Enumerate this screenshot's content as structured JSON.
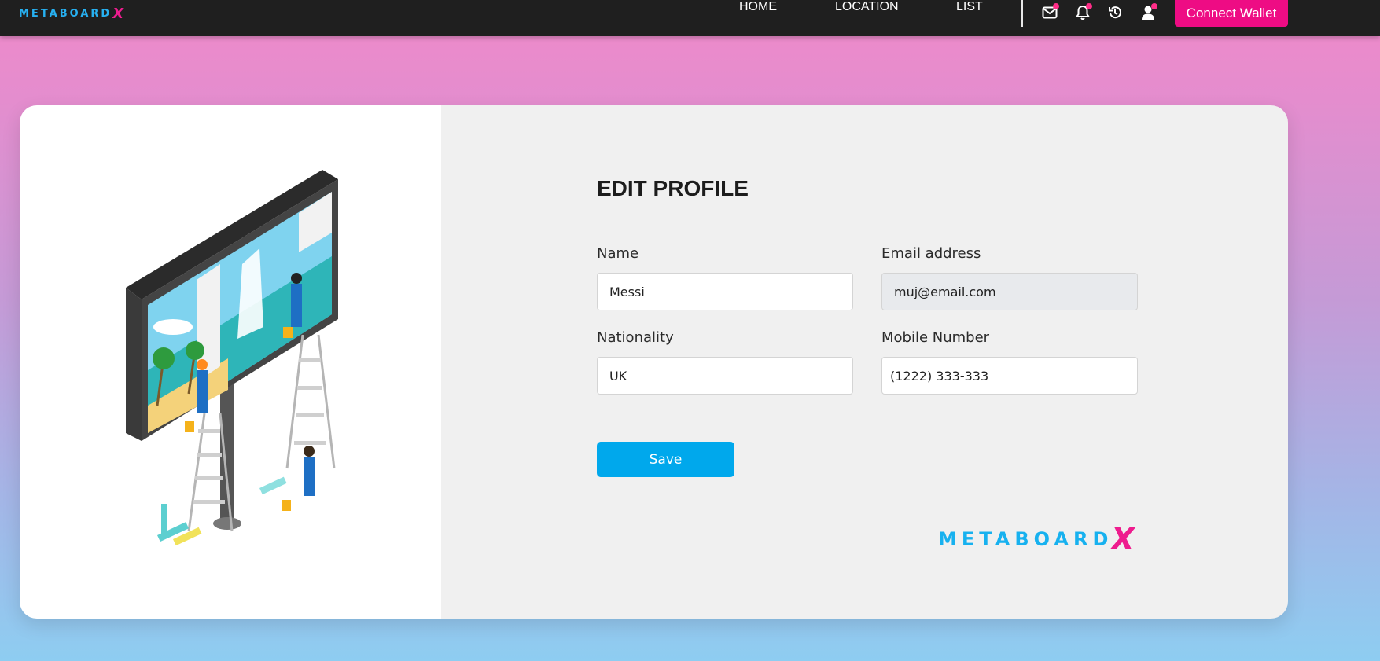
{
  "brand": {
    "name_small": "METABOARD",
    "x_small": "X",
    "name_big": "METABOARD",
    "x_big": "X"
  },
  "nav": {
    "links": [
      {
        "label": "HOME"
      },
      {
        "label": "LOCATION"
      },
      {
        "label": "LIST"
      }
    ],
    "icons": [
      "mail-icon",
      "bell-icon",
      "history-icon",
      "user-icon"
    ],
    "connect_label": "Connect Wallet"
  },
  "colors": {
    "accent_pink": "#ee0c84",
    "save_blue": "#00a8ec",
    "brand_blue": "#17b1ef"
  },
  "form": {
    "title": "EDIT PROFILE",
    "name": {
      "label": "Name",
      "value": "Messi"
    },
    "email": {
      "label": "Email address",
      "value": "muj@email.com"
    },
    "nationality": {
      "label": "Nationality",
      "value": "UK"
    },
    "mobile": {
      "label": "Mobile Number",
      "value": "(1222) 333-333"
    },
    "save_label": "Save"
  }
}
